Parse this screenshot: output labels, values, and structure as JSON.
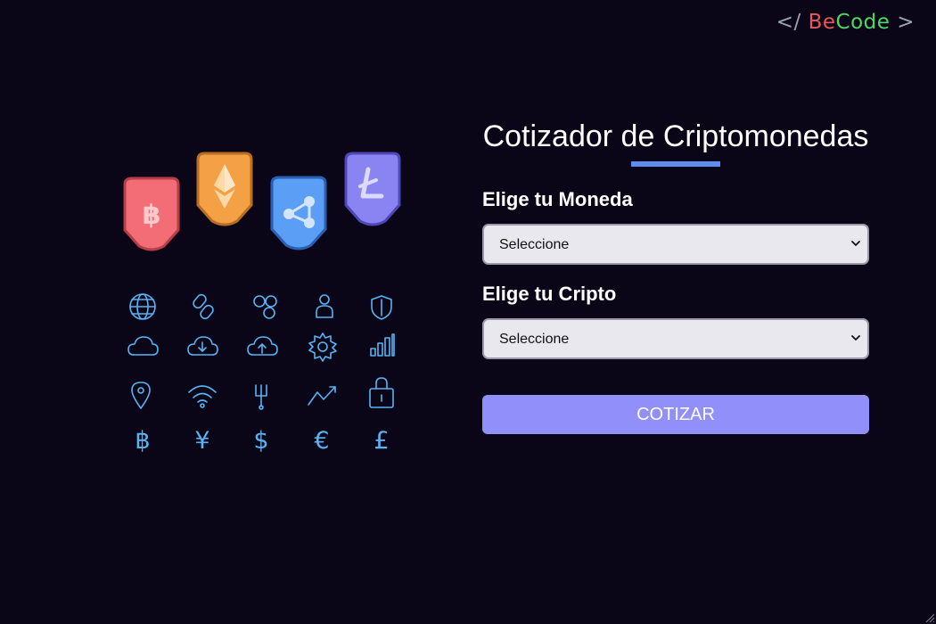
{
  "logo": {
    "open_bracket": "</",
    "brand_part1": "Be",
    "brand_part2": "Code",
    "close_bracket": ">"
  },
  "illustration": {
    "coin_badges": [
      "bitcoin",
      "ethereum",
      "ripple",
      "litecoin"
    ],
    "icons": [
      "globe-icon",
      "chain-link-icon",
      "network-nodes-icon",
      "user-icon",
      "shield-icon",
      "cloud-icon",
      "cloud-download-icon",
      "cloud-upload-icon",
      "gear-icon",
      "bar-chart-icon",
      "location-pin-icon",
      "wifi-icon",
      "usb-icon",
      "trending-up-icon",
      "padlock-icon",
      "bitcoin-symbol-icon",
      "yen-symbol-icon",
      "dollar-symbol-icon",
      "euro-symbol-icon",
      "pound-symbol-icon"
    ],
    "colors": {
      "bitcoin": "#f26d75",
      "ethereum": "#f4a045",
      "ripple": "#5a9ff5",
      "litecoin": "#8a84f3",
      "icon_stroke": "#56b4f5"
    }
  },
  "form": {
    "title": "Cotizador de Criptomonedas",
    "moneda_label": "Elige tu Moneda",
    "moneda_value": "Seleccione",
    "cripto_label": "Elige tu Cripto",
    "cripto_value": "Seleccione",
    "submit_label": "Cotizar"
  },
  "colors": {
    "background": "#0b0617",
    "accent": "#5b8ef0",
    "button": "#918ff9",
    "logo_be": "#e9575b",
    "logo_code": "#4bd864"
  }
}
